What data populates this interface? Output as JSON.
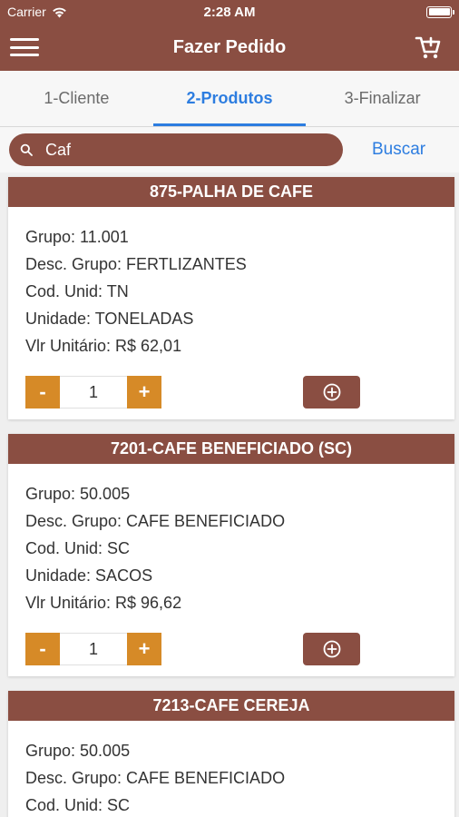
{
  "status": {
    "carrier": "Carrier",
    "time": "2:28 AM"
  },
  "header": {
    "title": "Fazer Pedido"
  },
  "tabs": [
    {
      "label": "1-Cliente"
    },
    {
      "label": "2-Produtos"
    },
    {
      "label": "3-Finalizar"
    }
  ],
  "search": {
    "value": "Caf",
    "button": "Buscar"
  },
  "products": [
    {
      "title": "875-PALHA DE CAFE",
      "grupo": "Grupo: 11.001",
      "desc_grupo": "Desc. Grupo: FERTLIZANTES",
      "cod_unid": "Cod. Unid: TN",
      "unidade": "Unidade: TONELADAS",
      "vlr": "Vlr Unitário: R$ 62,01",
      "qty": "1"
    },
    {
      "title": "7201-CAFE BENEFICIADO (SC)",
      "grupo": "Grupo: 50.005",
      "desc_grupo": "Desc. Grupo: CAFE BENEFICIADO",
      "cod_unid": "Cod. Unid: SC",
      "unidade": "Unidade: SACOS",
      "vlr": "Vlr Unitário: R$ 96,62",
      "qty": "1"
    },
    {
      "title": "7213-CAFE CEREJA",
      "grupo": "Grupo: 50.005",
      "desc_grupo": "Desc. Grupo: CAFE BENEFICIADO",
      "cod_unid": "Cod. Unid: SC"
    }
  ],
  "stepper": {
    "minus": "-",
    "plus": "+"
  },
  "colors": {
    "brand": "#8a4e42",
    "accent": "#2d7de0",
    "stepper": "#d68a27"
  },
  "icons": {
    "menu": "hamburger-menu-icon",
    "cart": "cart-icon",
    "search": "search-icon",
    "add": "add-circle-icon",
    "wifi": "wifi-icon",
    "battery": "battery-icon"
  }
}
